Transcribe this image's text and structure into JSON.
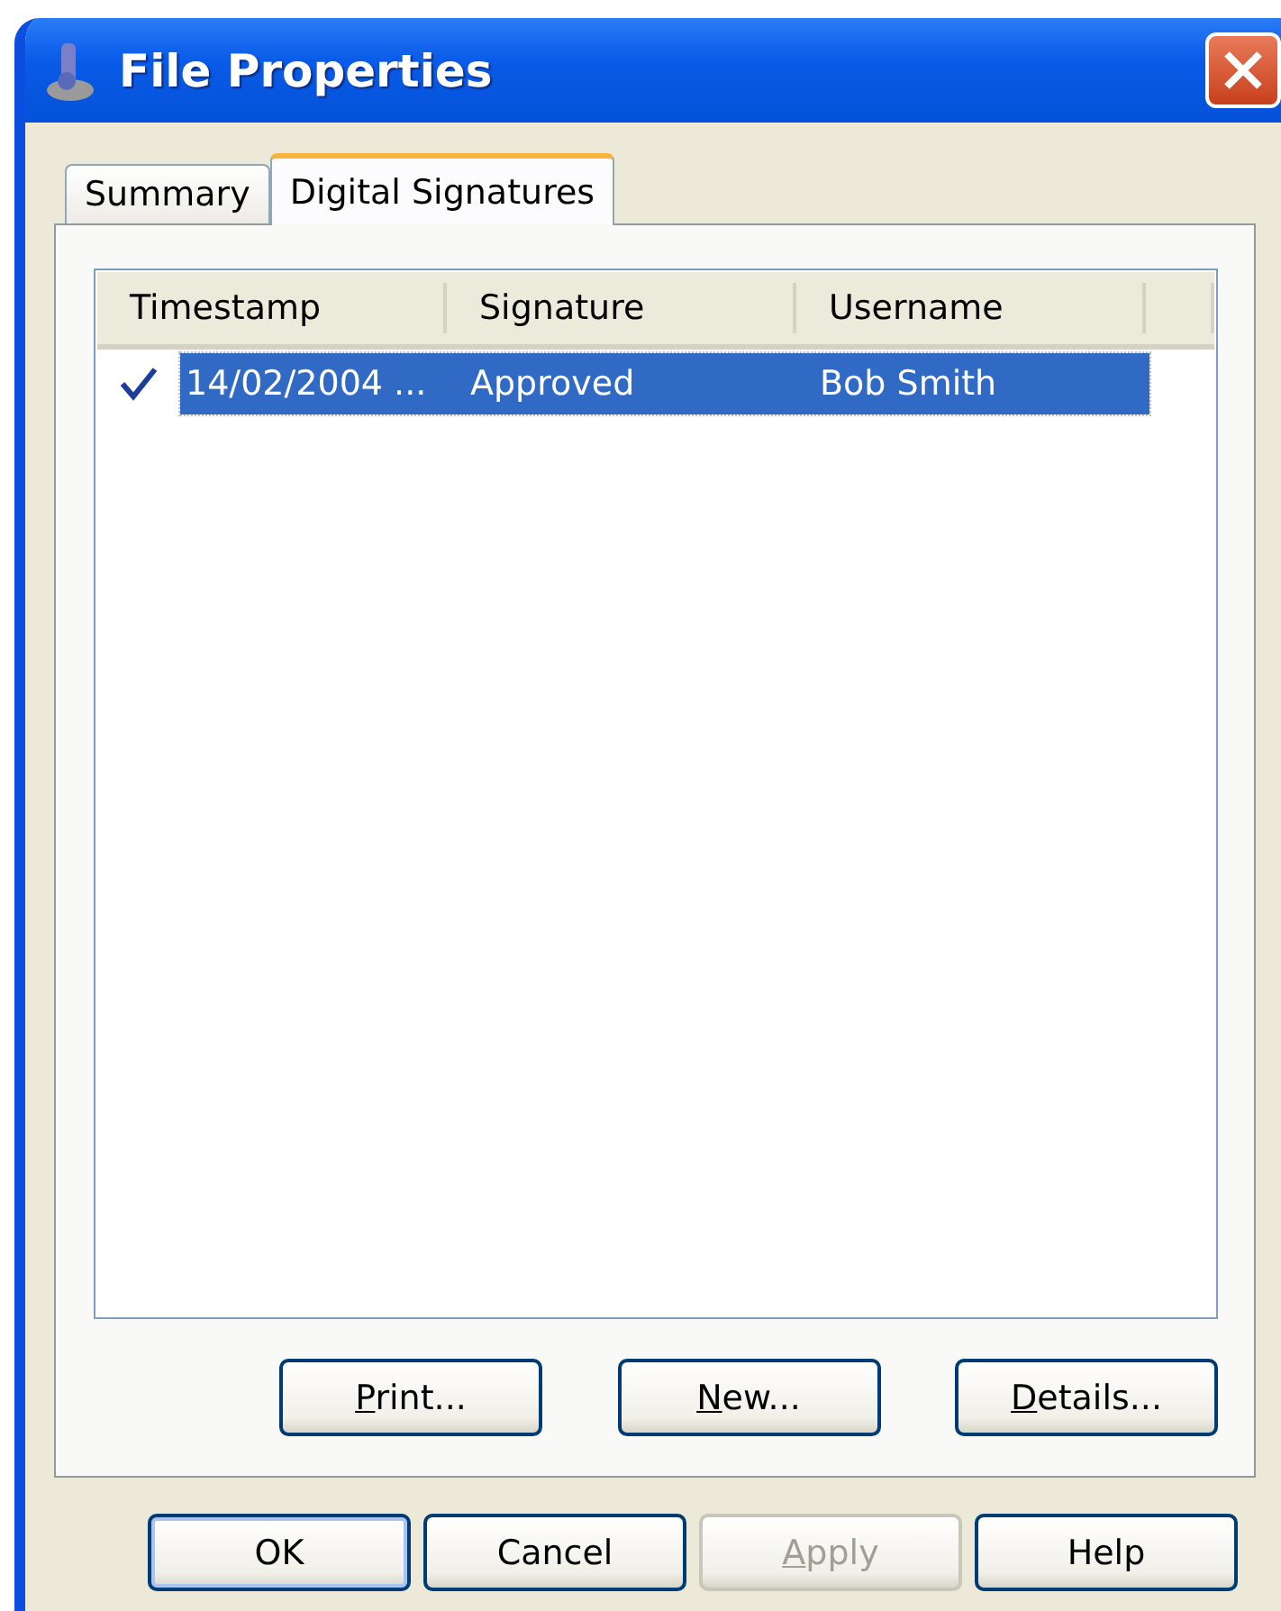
{
  "window": {
    "title": "File Properties"
  },
  "tabs": [
    {
      "label": "Summary",
      "selected": false
    },
    {
      "label": "Digital Signatures",
      "selected": true
    }
  ],
  "table": {
    "columns": [
      "Timestamp",
      "Signature",
      "Username"
    ],
    "rows": [
      {
        "cells": [
          "14/02/2004 ...",
          "Approved",
          "Bob Smith"
        ],
        "checked": true,
        "selected": true
      }
    ]
  },
  "panel_buttons": [
    {
      "label": "Print...",
      "mnemonic_underlined": true,
      "disabled": false
    },
    {
      "label": "New...",
      "mnemonic_underlined": true,
      "disabled": false
    },
    {
      "label": "Details...",
      "mnemonic_underlined": true,
      "disabled": false
    }
  ],
  "dialog_buttons": [
    {
      "label": "OK",
      "mnemonic_underlined": false,
      "disabled": false,
      "default": true
    },
    {
      "label": "Cancel",
      "mnemonic_underlined": false,
      "disabled": false,
      "default": false
    },
    {
      "label": "Apply",
      "mnemonic_underlined": true,
      "disabled": true,
      "default": false
    },
    {
      "label": "Help",
      "mnemonic_underlined": false,
      "disabled": false,
      "default": false
    }
  ]
}
